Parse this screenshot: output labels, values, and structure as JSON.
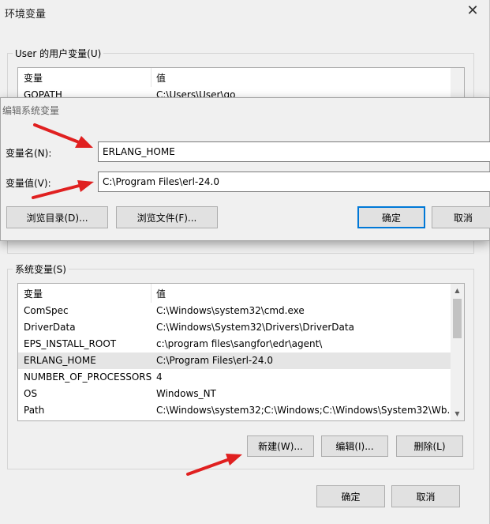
{
  "main_window": {
    "title": "环境变量",
    "close_glyph": "✕"
  },
  "user_vars": {
    "group_label": "User 的用户变量(U)",
    "headers": [
      "变量",
      "值"
    ],
    "rows": [
      {
        "name": "GOPATH",
        "value": "C:\\Users\\User\\go"
      }
    ]
  },
  "edit_dialog": {
    "title": "编辑系统变量",
    "name_label": "变量名(N):",
    "name_value": "ERLANG_HOME",
    "value_label": "变量值(V):",
    "value_value": "C:\\Program Files\\erl-24.0",
    "browse_dir_label": "浏览目录(D)...",
    "browse_file_label": "浏览文件(F)...",
    "ok_label": "确定",
    "cancel_label": "取消"
  },
  "sys_vars": {
    "group_label": "系统变量(S)",
    "headers": [
      "变量",
      "值"
    ],
    "rows": [
      {
        "name": "ComSpec",
        "value": "C:\\Windows\\system32\\cmd.exe"
      },
      {
        "name": "DriverData",
        "value": "C:\\Windows\\System32\\Drivers\\DriverData"
      },
      {
        "name": "EPS_INSTALL_ROOT",
        "value": "c:\\program files\\sangfor\\edr\\agent\\"
      },
      {
        "name": "ERLANG_HOME",
        "value": "C:\\Program Files\\erl-24.0"
      },
      {
        "name": "NUMBER_OF_PROCESSORS",
        "value": "4"
      },
      {
        "name": "OS",
        "value": "Windows_NT"
      },
      {
        "name": "Path",
        "value": "C:\\Windows\\system32;C:\\Windows;C:\\Windows\\System32\\Wb..."
      }
    ],
    "selected_row": "ERLANG_HOME",
    "new_label": "新建(W)...",
    "edit_label": "编辑(I)...",
    "delete_label": "删除(L)"
  },
  "footer": {
    "ok_label": "确定",
    "cancel_label": "取消"
  },
  "scroll_glyphs": {
    "up": "▲",
    "down": "▼"
  },
  "colors": {
    "annotation_arrow": "#e02020",
    "default_button_border": "#0078d7",
    "selected_row_bg": "#e5e5e5"
  }
}
